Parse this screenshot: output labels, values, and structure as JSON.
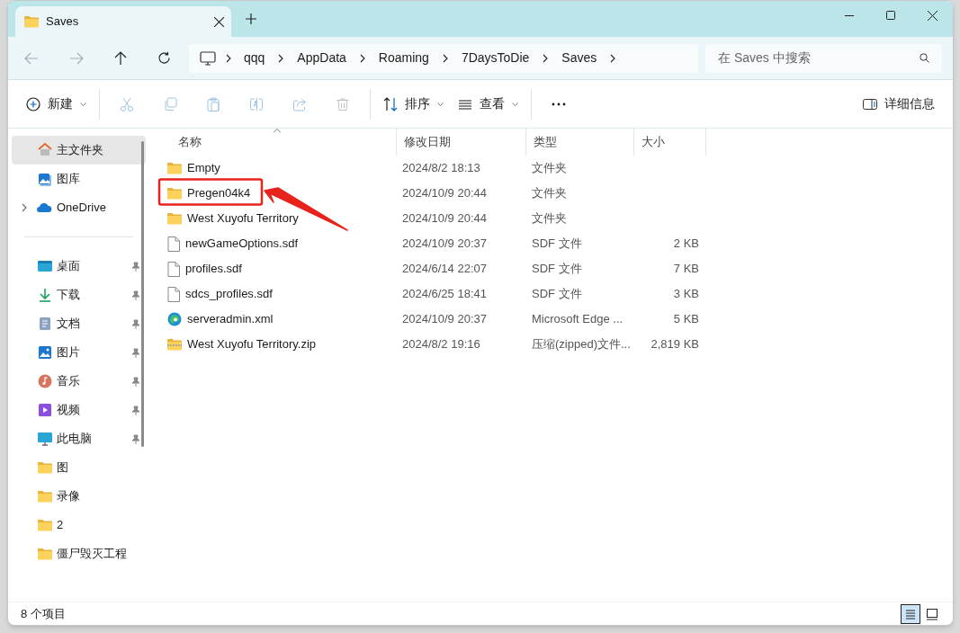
{
  "tabs": [
    {
      "label": "Saves",
      "selected": true
    }
  ],
  "breadcrumbs": [
    "qqq",
    "AppData",
    "Roaming",
    "7DaysToDie",
    "Saves"
  ],
  "search": {
    "placeholder": "在 Saves 中搜索"
  },
  "toolbar": {
    "new_button": {
      "kind": "new",
      "label": "新建"
    },
    "edit_actions": [
      {
        "kind": "cut",
        "disabled": true
      },
      {
        "kind": "copy",
        "disabled": true
      },
      {
        "kind": "paste",
        "disabled": true
      },
      {
        "kind": "rename",
        "disabled": true
      },
      {
        "kind": "share",
        "disabled": true
      },
      {
        "kind": "delete",
        "disabled": true
      }
    ],
    "tools": [
      {
        "kind": "sort",
        "label": "排序"
      },
      {
        "kind": "view",
        "label": "查看"
      },
      {
        "kind": "more"
      }
    ]
  },
  "details_button": {
    "label": "详细信息"
  },
  "sidebar": {
    "sections": [
      [
        {
          "kind": "home",
          "label": "主文件夹",
          "selected": true,
          "pinned": false,
          "expandable": false
        },
        {
          "kind": "gallery",
          "label": "图库",
          "selected": false,
          "pinned": false,
          "expandable": false
        },
        {
          "kind": "onedrive",
          "label": "OneDrive",
          "selected": false,
          "pinned": false,
          "expandable": true
        }
      ],
      [
        {
          "kind": "desktop",
          "label": "桌面",
          "selected": false,
          "pinned": true,
          "expandable": false
        },
        {
          "kind": "download",
          "label": "下载",
          "selected": false,
          "pinned": true,
          "expandable": false
        },
        {
          "kind": "document",
          "label": "文档",
          "selected": false,
          "pinned": true,
          "expandable": false
        },
        {
          "kind": "pictures",
          "label": "图片",
          "selected": false,
          "pinned": true,
          "expandable": false
        },
        {
          "kind": "music",
          "label": "音乐",
          "selected": false,
          "pinned": true,
          "expandable": false
        },
        {
          "kind": "video",
          "label": "视频",
          "selected": false,
          "pinned": true,
          "expandable": false
        },
        {
          "kind": "pc",
          "label": "此电脑",
          "selected": false,
          "pinned": true,
          "expandable": false
        },
        {
          "kind": "folder",
          "label": "图",
          "selected": false,
          "pinned": false,
          "expandable": false
        },
        {
          "kind": "folder",
          "label": "录像",
          "selected": false,
          "pinned": false,
          "expandable": false
        },
        {
          "kind": "folder",
          "label": "2",
          "selected": false,
          "pinned": false,
          "expandable": false
        },
        {
          "kind": "folder",
          "label": "僵尸毁灭工程",
          "selected": false,
          "pinned": false,
          "expandable": false
        }
      ]
    ]
  },
  "table": {
    "columns": [
      {
        "label": "名称",
        "sorted": true
      },
      {
        "label": "修改日期",
        "sorted": false
      },
      {
        "label": "类型",
        "sorted": false
      },
      {
        "label": "大小",
        "sorted": false
      }
    ],
    "rows": [
      {
        "kind": "folder",
        "name": "Empty",
        "date": "2024/8/2 18:13",
        "type": "文件夹",
        "annotated": false
      },
      {
        "kind": "folder",
        "name": "Pregen04k4",
        "date": "2024/10/9 20:44",
        "type": "文件夹",
        "annotated": true
      },
      {
        "kind": "folder",
        "name": "West Xuyofu Territory",
        "date": "2024/10/9 20:44",
        "type": "文件夹",
        "annotated": false
      },
      {
        "kind": "file",
        "name": "newGameOptions.sdf",
        "date": "2024/10/9 20:37",
        "type": "SDF 文件",
        "size": "2 KB",
        "annotated": false
      },
      {
        "kind": "file",
        "name": "profiles.sdf",
        "date": "2024/6/14 22:07",
        "type": "SDF 文件",
        "size": "7 KB",
        "annotated": false
      },
      {
        "kind": "file",
        "name": "sdcs_profiles.sdf",
        "date": "2024/6/25 18:41",
        "type": "SDF 文件",
        "size": "3 KB",
        "annotated": false
      },
      {
        "kind": "edge",
        "name": "serveradmin.xml",
        "date": "2024/10/9 20:37",
        "type": "Microsoft Edge ...",
        "size": "5 KB",
        "annotated": false
      },
      {
        "kind": "zip",
        "name": "West Xuyofu Territory.zip",
        "date": "2024/8/2 19:16",
        "type": "压缩(zipped)文件...",
        "size": "2,819 KB",
        "annotated": false
      }
    ]
  },
  "status_bar": {
    "text": "8 个项目",
    "view_modes": [
      {
        "kind": "details",
        "selected": true
      },
      {
        "kind": "tiles",
        "selected": false
      }
    ]
  }
}
